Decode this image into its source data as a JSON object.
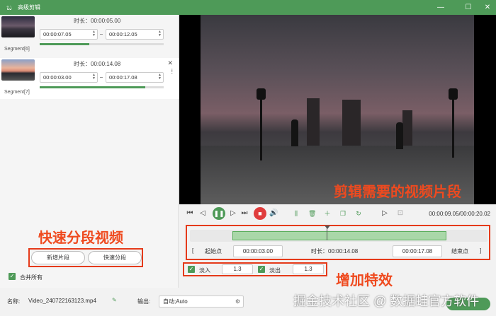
{
  "window": {
    "title": "高级剪辑",
    "app_icon": "frog-logo-icon"
  },
  "segments": [
    {
      "name": "Segment[6]",
      "duration_label": "时长：00:00:05.00",
      "start": "00:00:07.05",
      "end": "00:00:12.05",
      "selected": false,
      "progress": 0.4
    },
    {
      "name": "Segment[7]",
      "duration_label": "时长：00:00:14.08",
      "start": "00:00:03.00",
      "end": "00:00:17.08",
      "selected": true,
      "progress": 0.85
    }
  ],
  "left_panel": {
    "new_segment_label": "新增片段",
    "quick_split_label": "快速分段",
    "merge_all_label": "合并所有",
    "merge_all_checked": true
  },
  "annotations": {
    "quick_split_caption": "快速分段视频",
    "clip_caption": "剪辑需要的视频片段",
    "effects_caption": "增加特效"
  },
  "player": {
    "time_readout": "00:00:09.05/00:00:20.02",
    "playhead_position": 0.46
  },
  "trim": {
    "start_button_label": "起始点",
    "start_bracket": "[",
    "start_time": "00:00:03.00",
    "duration_label": "时长：00:00:14.08",
    "end_time": "00:00:17.08",
    "end_button_label": "结束点",
    "end_bracket": "]"
  },
  "effects": {
    "fade_in_label": "淡入",
    "fade_in_value": "1.3",
    "fade_in_checked": true,
    "fade_out_label": "淡出",
    "fade_out_value": "1.3",
    "fade_out_checked": true
  },
  "footer": {
    "name_label": "名称:",
    "file_name": "Video_240722163123.mp4",
    "output_label": "输出:",
    "output_value": "自动;Auto"
  },
  "watermark": "掘金技术社区 @ 数据蛙官方软件",
  "colors": {
    "accent": "#4e9a58",
    "annotation": "#ef4a1f",
    "record": "#e03c3c"
  }
}
